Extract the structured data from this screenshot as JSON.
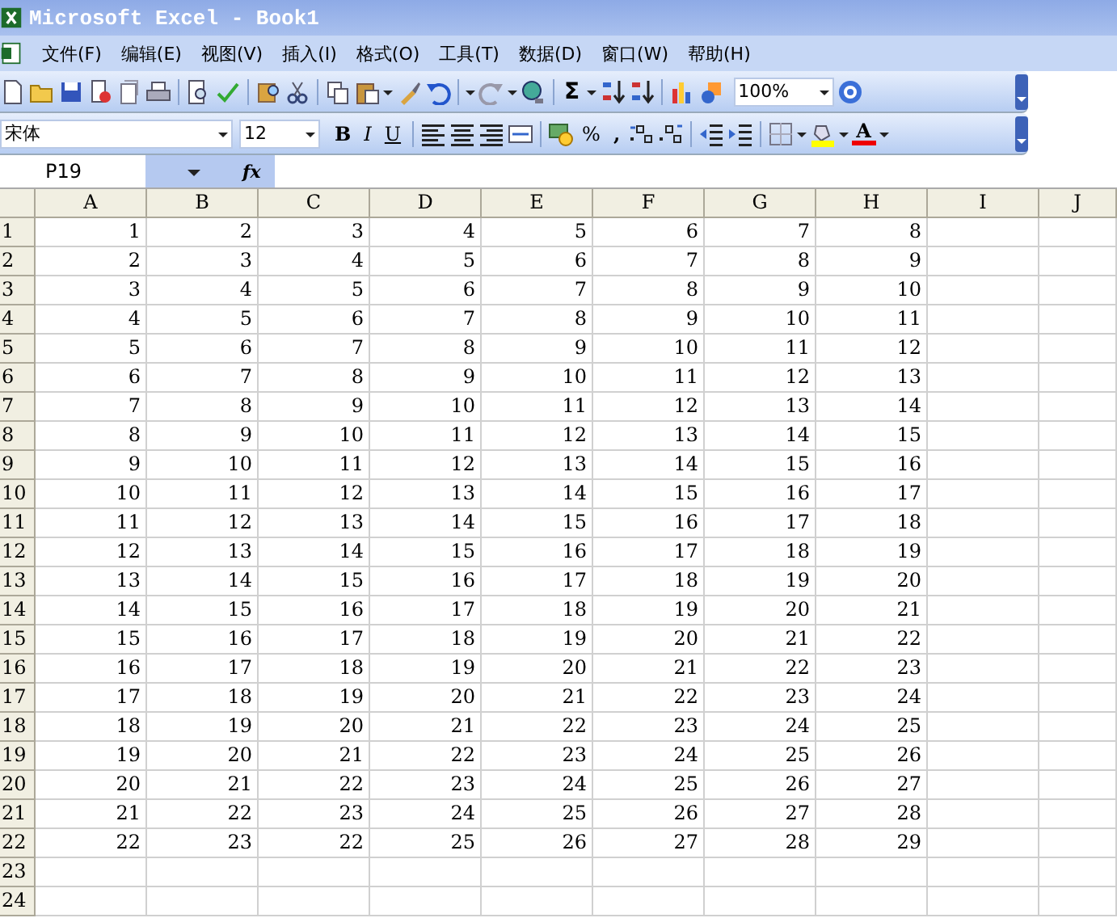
{
  "window": {
    "title": "Microsoft Excel - Book1"
  },
  "menu": [
    "文件(F)",
    "编辑(E)",
    "视图(V)",
    "插入(I)",
    "格式(O)",
    "工具(T)",
    "数据(D)",
    "窗口(W)",
    "帮助(H)"
  ],
  "standard_toolbar": {
    "sum": "Σ",
    "zoom": "100%"
  },
  "format_toolbar": {
    "font": "宋体",
    "size": "12",
    "bold": "B",
    "italic": "I",
    "underline": "U",
    "percent": "%",
    "comma": ",",
    "font_color": "A"
  },
  "formula_bar": {
    "name_box": "P19",
    "fx": "fx"
  },
  "columns": [
    "A",
    "B",
    "C",
    "D",
    "E",
    "F",
    "G",
    "H",
    "I",
    "J"
  ],
  "rows": [
    {
      "header": "1",
      "cells": [
        "1",
        "2",
        "3",
        "4",
        "5",
        "6",
        "7",
        "8"
      ]
    },
    {
      "header": "2",
      "cells": [
        "2",
        "3",
        "4",
        "5",
        "6",
        "7",
        "8",
        "9"
      ]
    },
    {
      "header": "3",
      "cells": [
        "3",
        "4",
        "5",
        "6",
        "7",
        "8",
        "9",
        "10"
      ]
    },
    {
      "header": "4",
      "cells": [
        "4",
        "5",
        "6",
        "7",
        "8",
        "9",
        "10",
        "11"
      ]
    },
    {
      "header": "5",
      "cells": [
        "5",
        "6",
        "7",
        "8",
        "9",
        "10",
        "11",
        "12"
      ]
    },
    {
      "header": "6",
      "cells": [
        "6",
        "7",
        "8",
        "9",
        "10",
        "11",
        "12",
        "13"
      ]
    },
    {
      "header": "7",
      "cells": [
        "7",
        "8",
        "9",
        "10",
        "11",
        "12",
        "13",
        "14"
      ]
    },
    {
      "header": "8",
      "cells": [
        "8",
        "9",
        "10",
        "11",
        "12",
        "13",
        "14",
        "15"
      ]
    },
    {
      "header": "9",
      "cells": [
        "9",
        "10",
        "11",
        "12",
        "13",
        "14",
        "15",
        "16"
      ]
    },
    {
      "header": "10",
      "cells": [
        "10",
        "11",
        "12",
        "13",
        "14",
        "15",
        "16",
        "17"
      ]
    },
    {
      "header": "11",
      "cells": [
        "11",
        "12",
        "13",
        "14",
        "15",
        "16",
        "17",
        "18"
      ]
    },
    {
      "header": "12",
      "cells": [
        "12",
        "13",
        "14",
        "15",
        "16",
        "17",
        "18",
        "19"
      ]
    },
    {
      "header": "13",
      "cells": [
        "13",
        "14",
        "15",
        "16",
        "17",
        "18",
        "19",
        "20"
      ]
    },
    {
      "header": "14",
      "cells": [
        "14",
        "15",
        "16",
        "17",
        "18",
        "19",
        "20",
        "21"
      ]
    },
    {
      "header": "15",
      "cells": [
        "15",
        "16",
        "17",
        "18",
        "19",
        "20",
        "21",
        "22"
      ]
    },
    {
      "header": "16",
      "cells": [
        "16",
        "17",
        "18",
        "19",
        "20",
        "21",
        "22",
        "23"
      ]
    },
    {
      "header": "17",
      "cells": [
        "17",
        "18",
        "19",
        "20",
        "21",
        "22",
        "23",
        "24"
      ]
    },
    {
      "header": "18",
      "cells": [
        "18",
        "19",
        "20",
        "21",
        "22",
        "23",
        "24",
        "25"
      ]
    },
    {
      "header": "19",
      "cells": [
        "19",
        "20",
        "21",
        "22",
        "23",
        "24",
        "25",
        "26"
      ]
    },
    {
      "header": "20",
      "cells": [
        "20",
        "21",
        "22",
        "23",
        "24",
        "25",
        "26",
        "27"
      ]
    },
    {
      "header": "21",
      "cells": [
        "21",
        "22",
        "23",
        "24",
        "25",
        "26",
        "27",
        "28"
      ]
    },
    {
      "header": "22",
      "cells": [
        "22",
        "23",
        "22",
        "25",
        "26",
        "27",
        "28",
        "29"
      ]
    },
    {
      "header": "23",
      "cells": []
    },
    {
      "header": "24",
      "cells": []
    }
  ]
}
